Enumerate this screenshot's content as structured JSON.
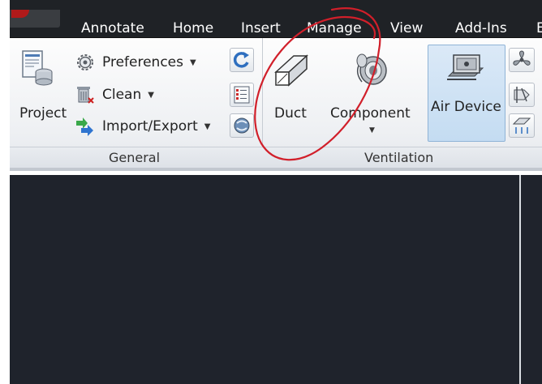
{
  "tabs": [
    "Annotate",
    "Home",
    "Insert",
    "Manage",
    "View",
    "Add-Ins",
    "E"
  ],
  "panels": {
    "general": {
      "title": "General",
      "project_label": "Project",
      "items": [
        {
          "label": "Preferences",
          "icon": "gear-icon"
        },
        {
          "label": "Clean",
          "icon": "cleanup-icon"
        },
        {
          "label": "Import/Export",
          "icon": "import-export-icon"
        }
      ]
    },
    "ventilation": {
      "title": "Ventilation",
      "duct_label": "Duct",
      "component_label": "Component",
      "air_device_label": "Air Device"
    }
  },
  "colors": {
    "tabbar": "#1f2226",
    "canvas": "#1f232c",
    "selected_button": "#c4dcf2",
    "annotation_circle": "#d11f2a"
  }
}
